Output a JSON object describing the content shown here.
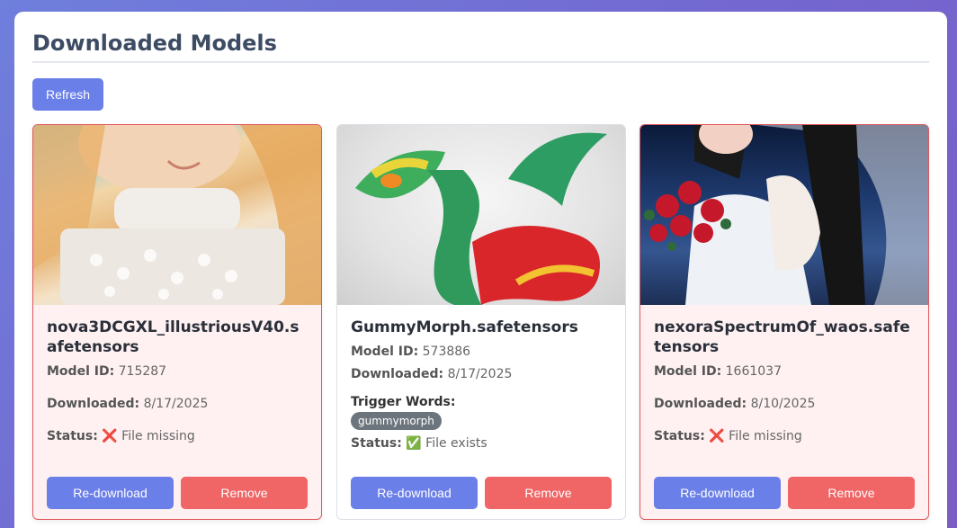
{
  "header": {
    "title": "Downloaded Models"
  },
  "toolbar": {
    "refresh_label": "Refresh"
  },
  "labels": {
    "model_id": "Model ID:",
    "downloaded": "Downloaded:",
    "status": "Status:",
    "trigger_words": "Trigger Words:",
    "redownload": "Re-download",
    "remove": "Remove"
  },
  "cards": [
    {
      "name": "nova3DCGXL_illustriousV40.safetensors",
      "model_id": "715287",
      "downloaded": "8/17/2025",
      "status_icon": "❌",
      "status_text": "File missing"
    },
    {
      "name": "GummyMorph.safetensors",
      "model_id": "573886",
      "downloaded": "8/17/2025",
      "trigger_words": [
        "gummymorph"
      ],
      "status_icon": "✅",
      "status_text": "File exists"
    },
    {
      "name": "nexoraSpectrumOf_waos.safetensors",
      "model_id": "1661037",
      "downloaded": "8/10/2025",
      "status_icon": "❌",
      "status_text": "File missing"
    }
  ],
  "colors": {
    "primary": "#6a7fe8",
    "danger": "#f06565",
    "missing_border": "#e0585e",
    "missing_bg": "#fff1f1",
    "tag_bg": "#6c757d"
  }
}
